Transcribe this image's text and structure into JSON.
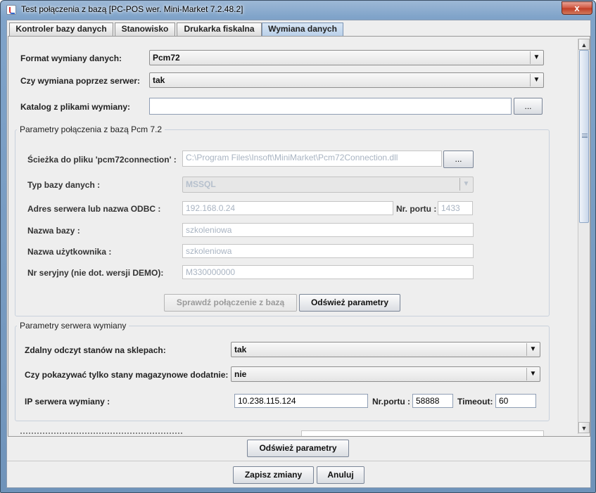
{
  "window": {
    "title": "Test połączenia z bazą [PC-POS wer. Mini-Market 7.2.48.2]",
    "close_label": "x"
  },
  "tabs": [
    {
      "label": "Kontroler bazy danych"
    },
    {
      "label": "Stanowisko"
    },
    {
      "label": "Drukarka fiskalna"
    },
    {
      "label": "Wymiana danych"
    }
  ],
  "top": {
    "format_label": "Format wymiany danych:",
    "format_value": "Pcm72",
    "server_label": "Czy wymiana poprzez serwer:",
    "server_value": "tak",
    "catalog_label": "Katalog z plikami wymiany:",
    "catalog_value": "",
    "browse_label": "..."
  },
  "pcm": {
    "title": "Parametry połączenia z bazą Pcm 7.2",
    "path_label": "Ścieżka do pliku 'pcm72connection' :",
    "path_value": "C:\\Program Files\\Insoft\\MiniMarket\\Pcm72Connection.dll",
    "browse_label": "...",
    "dbtype_label": "Typ bazy danych :",
    "dbtype_value": "MSSQL",
    "server_label": "Adres serwera lub nazwa ODBC :",
    "server_value": "192.168.0.24",
    "port_label": "Nr. portu :",
    "port_value": "1433",
    "dbname_label": "Nazwa bazy :",
    "dbname_value": "szkoleniowa",
    "user_label": "Nazwa użytkownika :",
    "user_value": "szkoleniowa",
    "serial_label": "Nr seryjny (nie dot. wersji DEMO):",
    "serial_value": "M330000000",
    "test_button": "Sprawdź połączenie z bazą",
    "refresh_button": "Odśwież parametry"
  },
  "exchange": {
    "title": "Parametry serwera wymiany",
    "remote_label": "Zdalny odczyt stanów na sklepach:",
    "remote_value": "tak",
    "positive_label": "Czy pokazywać tylko stany magazynowe dodatnie:",
    "positive_value": "nie",
    "ip_label": "IP serwera wymiany :",
    "ip_value": "10.238.115.124",
    "port_label": "Nr.portu :",
    "port_value": "58888",
    "timeout_label": "Timeout:",
    "timeout_value": "60"
  },
  "bottom": {
    "refresh_button": "Odśwież parametry",
    "save_button": "Zapisz zmiany",
    "cancel_button": "Anuluj"
  },
  "colors": {
    "accent": "#b8cfe8",
    "disabled_text": "#a9b4c2"
  }
}
